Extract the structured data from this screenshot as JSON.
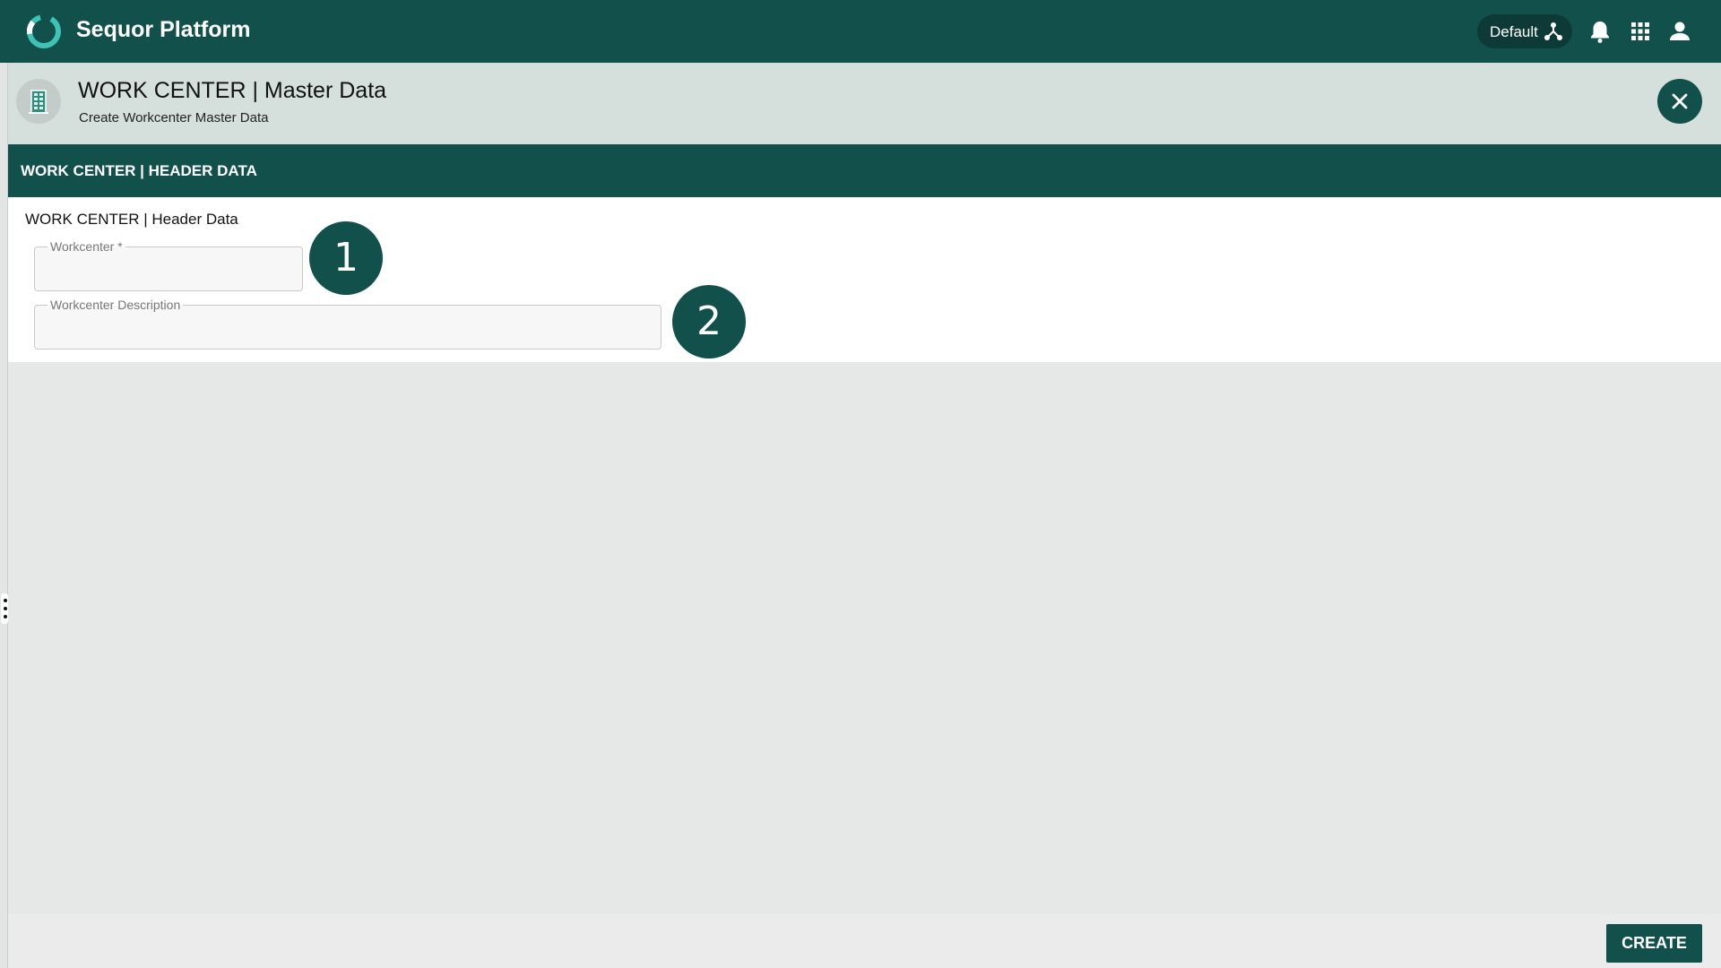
{
  "topbar": {
    "app_title": "Sequor Platform",
    "environment_label": "Default",
    "icons": [
      "sequor-logo-icon",
      "network-icon",
      "bell-icon",
      "apps-grid-icon",
      "user-icon"
    ]
  },
  "page_header": {
    "title": "WORK CENTER | Master Data",
    "subtitle": "Create Workcenter Master Data",
    "module_icon": "building-icon",
    "close_icon": "close-icon"
  },
  "section": {
    "title": "WORK CENTER | HEADER DATA"
  },
  "form": {
    "heading": "WORK CENTER | Header Data",
    "fields": [
      {
        "label": "Workcenter *",
        "value": "",
        "placeholder": ""
      },
      {
        "label": "Workcenter Description",
        "value": "",
        "placeholder": ""
      }
    ]
  },
  "annotations": [
    "1",
    "2"
  ],
  "footer": {
    "create_label": "CREATE"
  },
  "colors": {
    "primary": "#12504c",
    "header_bg": "#d5e0dd",
    "content_bg": "#e6e8e7",
    "accent_teal": "#3fc3b4"
  }
}
